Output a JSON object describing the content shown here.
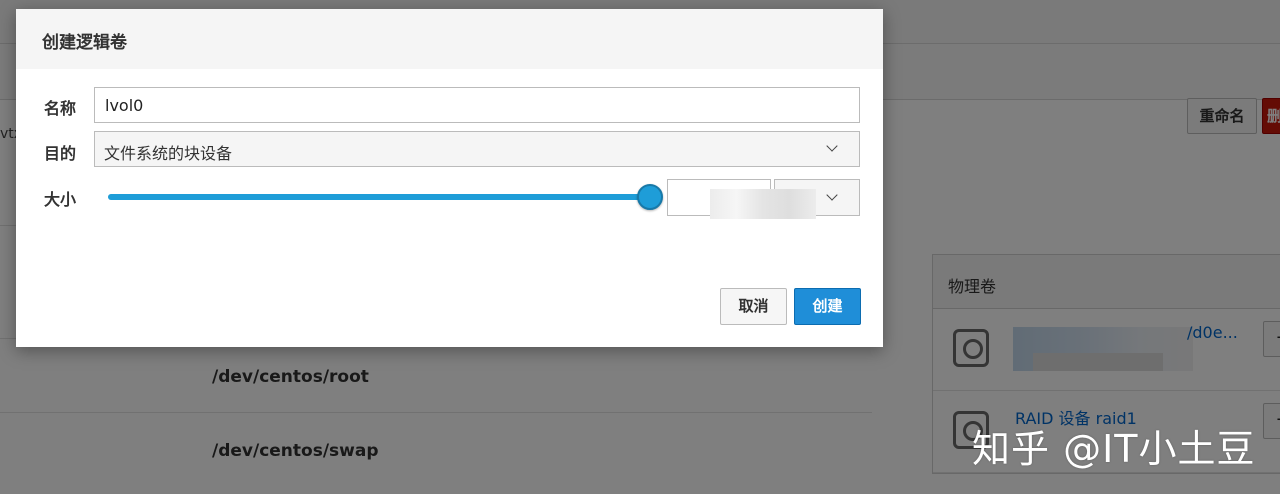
{
  "background": {
    "rename_label": "重命名",
    "delete_label": "删",
    "left_sliver_text": "vtx",
    "logical_volumes": [
      "/dev/centos/root",
      "/dev/centos/swap"
    ],
    "physical_volumes_panel": {
      "title": "物理卷",
      "items": [
        {
          "label": "",
          "suffix": "/d0e..."
        },
        {
          "label": "RAID 设备 raid1",
          "suffix": ""
        }
      ]
    }
  },
  "dialog": {
    "title": "创建逻辑卷",
    "name_label": "名称",
    "name_value": "lvol0",
    "purpose_label": "目的",
    "purpose_value": "文件系统的块设备",
    "size_label": "大小",
    "slider_fraction": 1.0,
    "cancel_label": "取消",
    "create_label": "创建"
  },
  "colors": {
    "accent": "#1e9dd8",
    "primary_button": "#1f8ed8",
    "danger": "#c9190b"
  },
  "watermark": "知乎 @IT小土豆"
}
